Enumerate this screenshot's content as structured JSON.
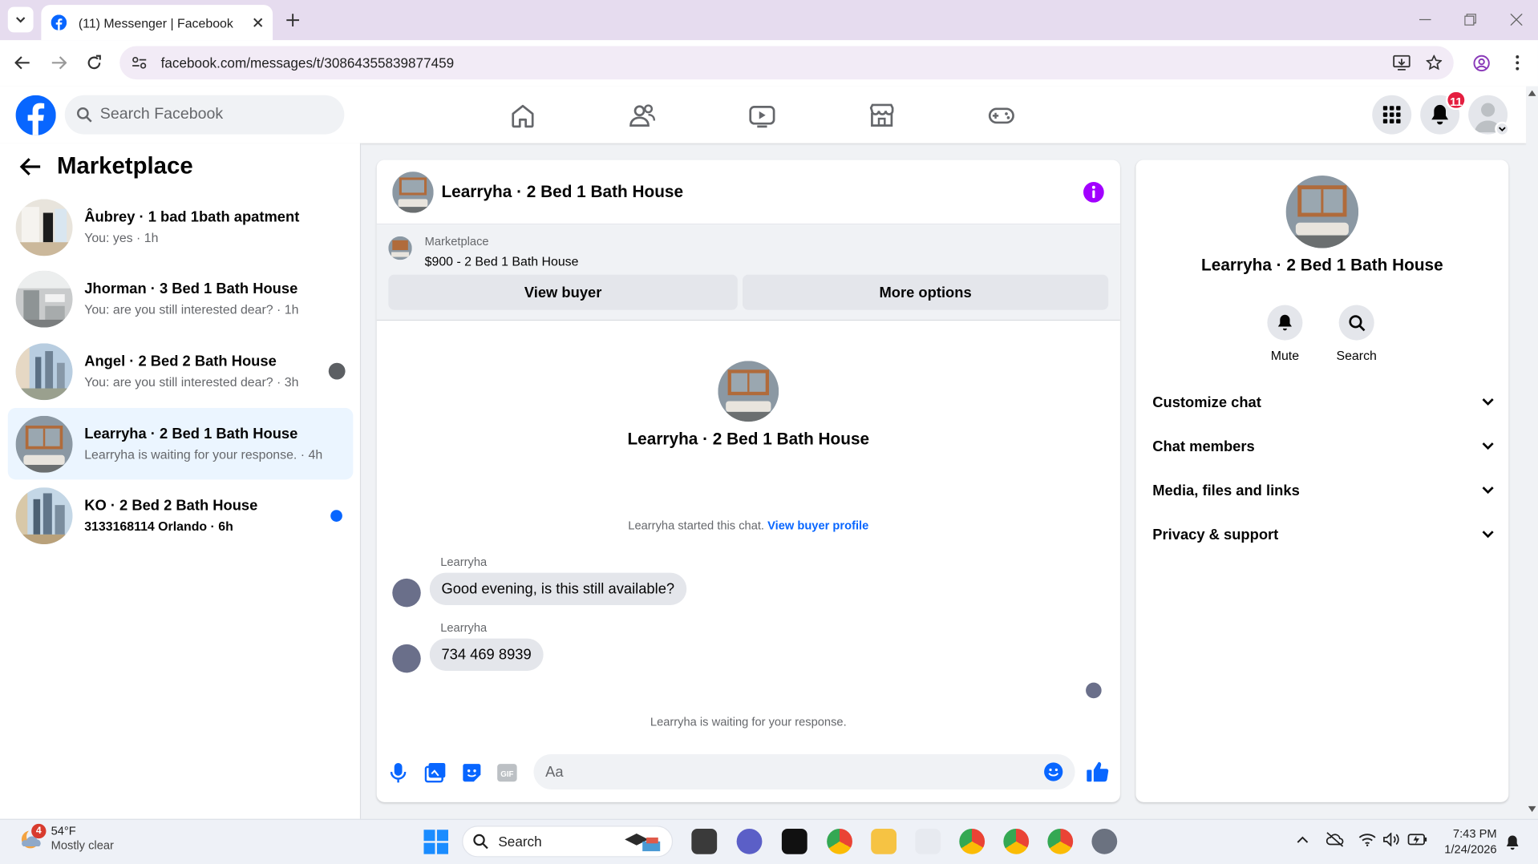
{
  "browser": {
    "tab_title": "(11) Messenger | Facebook",
    "url": "facebook.com/messages/t/30864355839877459",
    "new_tab_icon": "plus-icon"
  },
  "fb": {
    "search_placeholder": "Search Facebook",
    "notif_count": "11",
    "brand_color": "#0866ff"
  },
  "left": {
    "title": "Marketplace",
    "conversations": [
      {
        "name": "Âubrey · 1 bad 1bath apatment",
        "sub": "You: yes · 1h",
        "unread": false,
        "bold": false
      },
      {
        "name": "Jhorman · 3 Bed 1 Bath House",
        "sub": "You: are you still interested dear? · 1h",
        "unread": false,
        "bold": false
      },
      {
        "name": "Angel · 2 Bed 2 Bath House",
        "sub": "You: are you still interested dear? · 3h",
        "unread": false,
        "bold": false
      },
      {
        "name": "Learryha · 2 Bed 1 Bath House",
        "sub": "Learryha is waiting for your response. · 4h",
        "unread": false,
        "bold": false
      },
      {
        "name": "KO · 2 Bed 2 Bath House",
        "sub": "3133168114 Orlando · 6h",
        "unread": true,
        "bold": true
      }
    ]
  },
  "chat": {
    "title": "Learryha · 2 Bed 1 Bath House",
    "listing_label": "Marketplace",
    "listing_price": "$900 - 2 Bed 1 Bath House",
    "view_buyer": "View buyer",
    "more_options": "More options",
    "intro_name": "Learryha · 2 Bed 1 Bath House",
    "started_text": "Learryha started this chat.",
    "view_profile": "View buyer profile",
    "messages": [
      {
        "sender": "Learryha",
        "text": "Good evening, is this still available?"
      },
      {
        "sender": "Learryha",
        "text": "734 469 8939"
      }
    ],
    "waiting": "Learryha is waiting for your response.",
    "composer_placeholder": "Aa"
  },
  "info": {
    "name": "Learryha · 2 Bed 1 Bath House",
    "mute": "Mute",
    "search": "Search",
    "sections": [
      "Customize chat",
      "Chat members",
      "Media, files and links",
      "Privacy & support"
    ]
  },
  "taskbar": {
    "weather_temp": "54°F",
    "weather_desc": "Mostly clear",
    "weather_badge": "4",
    "search_label": "Search",
    "time": "7:43 PM",
    "date": "1/24/2026"
  }
}
